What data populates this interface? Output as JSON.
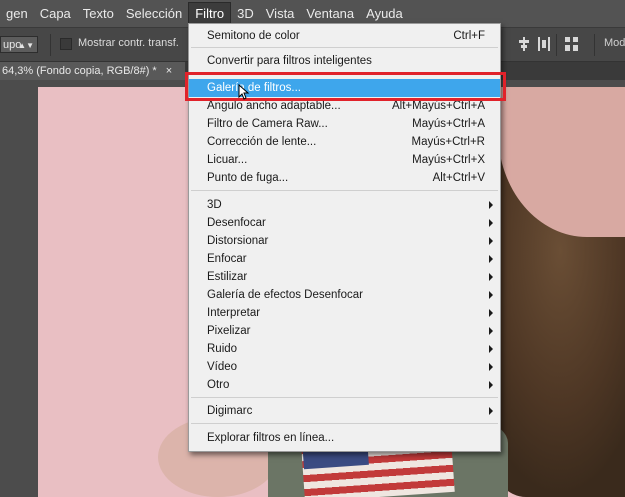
{
  "menubar": {
    "items": [
      {
        "label": "gen",
        "active": false
      },
      {
        "label": "Capa",
        "active": false
      },
      {
        "label": "Texto",
        "active": false
      },
      {
        "label": "Selección",
        "active": false
      },
      {
        "label": "Filtro",
        "active": true
      },
      {
        "label": "3D",
        "active": false
      },
      {
        "label": "Vista",
        "active": false
      },
      {
        "label": "Ventana",
        "active": false
      },
      {
        "label": "Ayuda",
        "active": false
      }
    ]
  },
  "options": {
    "select_value": "upo",
    "show_transform_label": "Mostrar contr. transf.",
    "mode_label": "Modo"
  },
  "document": {
    "tab_title": "64,3% (Fondo copia, RGB/8#) *",
    "close_glyph": "×"
  },
  "filter_menu": {
    "items": [
      {
        "id": "semitono",
        "label": "Semitono de color",
        "shortcut": "Ctrl+F"
      },
      {
        "id": "convertir",
        "label": "Convertir para filtros inteligentes",
        "shortcut": ""
      },
      {
        "id": "galeria",
        "label": "Galería de filtros...",
        "shortcut": "",
        "highlighted": true
      },
      {
        "id": "angulo",
        "label": "Ángulo ancho adaptable...",
        "shortcut": "Alt+Mayús+Ctrl+A"
      },
      {
        "id": "camera-raw",
        "label": "Filtro de Camera Raw...",
        "shortcut": "Mayús+Ctrl+A"
      },
      {
        "id": "correccion",
        "label": "Corrección de lente...",
        "shortcut": "Mayús+Ctrl+R"
      },
      {
        "id": "licuar",
        "label": "Licuar...",
        "shortcut": "Mayús+Ctrl+X"
      },
      {
        "id": "punto-fuga",
        "label": "Punto de fuga...",
        "shortcut": "Alt+Ctrl+V"
      },
      {
        "id": "3d",
        "label": "3D",
        "submenu": true
      },
      {
        "id": "desenfocar",
        "label": "Desenfocar",
        "submenu": true
      },
      {
        "id": "distorsionar",
        "label": "Distorsionar",
        "submenu": true
      },
      {
        "id": "enfocar",
        "label": "Enfocar",
        "submenu": true
      },
      {
        "id": "estilizar",
        "label": "Estilizar",
        "submenu": true
      },
      {
        "id": "galeria-efectos",
        "label": "Galería de efectos Desenfocar",
        "submenu": true
      },
      {
        "id": "interpretar",
        "label": "Interpretar",
        "submenu": true
      },
      {
        "id": "pixelizar",
        "label": "Pixelizar",
        "submenu": true
      },
      {
        "id": "ruido",
        "label": "Ruido",
        "submenu": true
      },
      {
        "id": "video",
        "label": "Vídeo",
        "submenu": true
      },
      {
        "id": "otro",
        "label": "Otro",
        "submenu": true
      },
      {
        "id": "digimarc",
        "label": "Digimarc",
        "submenu": true
      },
      {
        "id": "explorar",
        "label": "Explorar filtros en línea...",
        "shortcut": ""
      }
    ]
  },
  "colors": {
    "highlight": "#3ea6ec",
    "annotation_box": "#e1222a"
  }
}
